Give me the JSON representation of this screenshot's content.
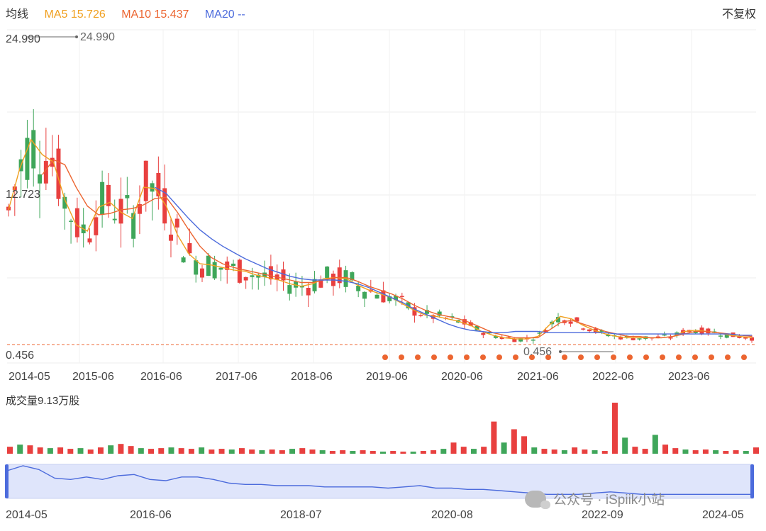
{
  "legend": {
    "label": "均线",
    "ma5": "MA5 15.726",
    "ma10": "MA10 15.437",
    "ma20": "MA20 --",
    "adjust": "不复权",
    "colors": {
      "ma5": "#f0a020",
      "ma10": "#ec6530",
      "ma20": "#4c6bdc",
      "up": "#e8403f",
      "down": "#3fa65a"
    }
  },
  "volume_title": "成交量9.13万股",
  "watermark": "公众号 · iSpiik小站",
  "chart_data": [
    {
      "type": "candlestick",
      "y_ticks": [
        "24.990",
        "12.723",
        "0.456"
      ],
      "ylim": [
        0.456,
        24.99
      ],
      "max_label": "24.990",
      "min_label": "0.456",
      "x_ticks": [
        "2014-05",
        "2015-06",
        "2016-06",
        "2017-06",
        "2018-06",
        "2019-06",
        "2020-06",
        "2021-06",
        "2022-06",
        "2023-06"
      ],
      "grid": true,
      "series": [
        {
          "name": "MA5",
          "values": [
            11.2,
            14.5,
            16.8,
            15.6,
            15.0,
            12.0,
            10.0,
            9.5,
            11.4,
            11.8,
            11.0,
            10.5,
            13.0,
            12.9,
            11.5,
            9.2,
            7.7,
            6.9,
            6.8,
            6.6,
            6.4,
            6.3,
            6.0,
            5.8,
            5.6,
            5.3,
            5.1,
            5.3,
            5.7,
            5.8,
            5.7,
            5.2,
            4.8,
            4.5,
            4.2,
            3.7,
            3.2,
            2.8,
            2.7,
            2.5,
            2.3,
            2.0,
            1.5,
            1.2,
            1.0,
            0.9,
            0.9,
            1.1,
            2.0,
            2.7,
            2.5,
            2.0,
            1.6,
            1.3,
            1.1,
            1.0,
            1.0,
            1.0,
            1.0,
            1.1,
            1.5,
            1.6,
            1.5,
            1.4,
            1.2,
            1.1,
            1.0
          ]
        },
        {
          "name": "MA10",
          "values": [
            null,
            null,
            null,
            14.0,
            15.2,
            14.8,
            13.0,
            11.5,
            10.8,
            10.9,
            11.2,
            11.3,
            11.6,
            12.1,
            12.2,
            11.0,
            9.6,
            8.3,
            7.4,
            6.9,
            6.6,
            6.4,
            6.2,
            6.0,
            5.8,
            5.6,
            5.4,
            5.4,
            5.6,
            5.8,
            5.8,
            5.5,
            5.1,
            4.8,
            4.5,
            4.1,
            3.6,
            3.2,
            2.9,
            2.7,
            2.5,
            2.2,
            1.8,
            1.4,
            1.2,
            1.0,
            1.0,
            1.0,
            1.6,
            2.2,
            2.4,
            2.1,
            1.8,
            1.5,
            1.3,
            1.1,
            1.1,
            1.0,
            1.0,
            1.1,
            1.3,
            1.5,
            1.5,
            1.4,
            1.3,
            1.2,
            1.1
          ]
        },
        {
          "name": "MA20",
          "values": [
            null,
            null,
            null,
            null,
            null,
            null,
            null,
            null,
            null,
            null,
            null,
            null,
            null,
            13.0,
            12.5,
            11.5,
            10.5,
            9.6,
            8.9,
            8.3,
            7.8,
            7.3,
            6.9,
            6.5,
            6.2,
            5.9,
            5.7,
            5.6,
            5.6,
            5.6,
            5.5,
            5.3,
            5.0,
            4.6,
            4.2,
            3.8,
            3.3,
            2.9,
            2.5,
            2.1,
            1.8,
            1.6,
            1.5,
            1.4,
            1.4,
            1.5,
            1.5,
            1.5,
            1.4,
            1.4,
            1.4,
            1.4,
            1.4,
            1.4,
            1.3,
            1.3,
            1.3,
            1.3,
            1.3,
            1.3,
            1.3,
            1.3,
            1.3,
            1.3,
            1.3,
            1.2,
            1.2
          ]
        }
      ]
    },
    {
      "type": "bar",
      "title": "成交量9.13万股",
      "values": [
        1.0,
        1.3,
        1.2,
        0.9,
        0.8,
        0.9,
        0.7,
        0.8,
        0.6,
        0.9,
        1.2,
        1.4,
        1.1,
        0.8,
        0.7,
        0.8,
        0.9,
        0.8,
        0.7,
        0.9,
        0.6,
        0.7,
        0.6,
        0.8,
        0.6,
        0.5,
        0.6,
        0.5,
        0.7,
        0.8,
        0.6,
        0.5,
        0.4,
        0.5,
        0.4,
        0.5,
        0.4,
        0.3,
        0.4,
        0.3,
        0.3,
        0.4,
        0.5,
        0.7,
        1.6,
        1.0,
        0.7,
        1.0,
        4.6,
        1.6,
        3.5,
        2.5,
        0.9,
        0.7,
        0.6,
        0.5,
        0.9,
        0.6,
        0.5,
        0.4,
        7.3,
        2.3,
        1.0,
        0.7,
        2.7,
        1.3,
        0.8,
        0.6,
        0.5,
        0.6,
        0.5,
        0.4,
        0.5,
        0.4,
        0.9
      ]
    },
    {
      "type": "area",
      "x_ticks": [
        "2014-05",
        "2016-06",
        "2018-07",
        "2020-08",
        "2022-09",
        "2024-05"
      ],
      "values": [
        20,
        24,
        21,
        14,
        13,
        15,
        13,
        16,
        17,
        13,
        12,
        15,
        15,
        13,
        10,
        9,
        9,
        8,
        8,
        8,
        7,
        7,
        7,
        7,
        6,
        7,
        8,
        6,
        6,
        5,
        5,
        4,
        3,
        2,
        1,
        1,
        1,
        2,
        3,
        2,
        1,
        1,
        1,
        1,
        1,
        1,
        1,
        1
      ]
    }
  ]
}
